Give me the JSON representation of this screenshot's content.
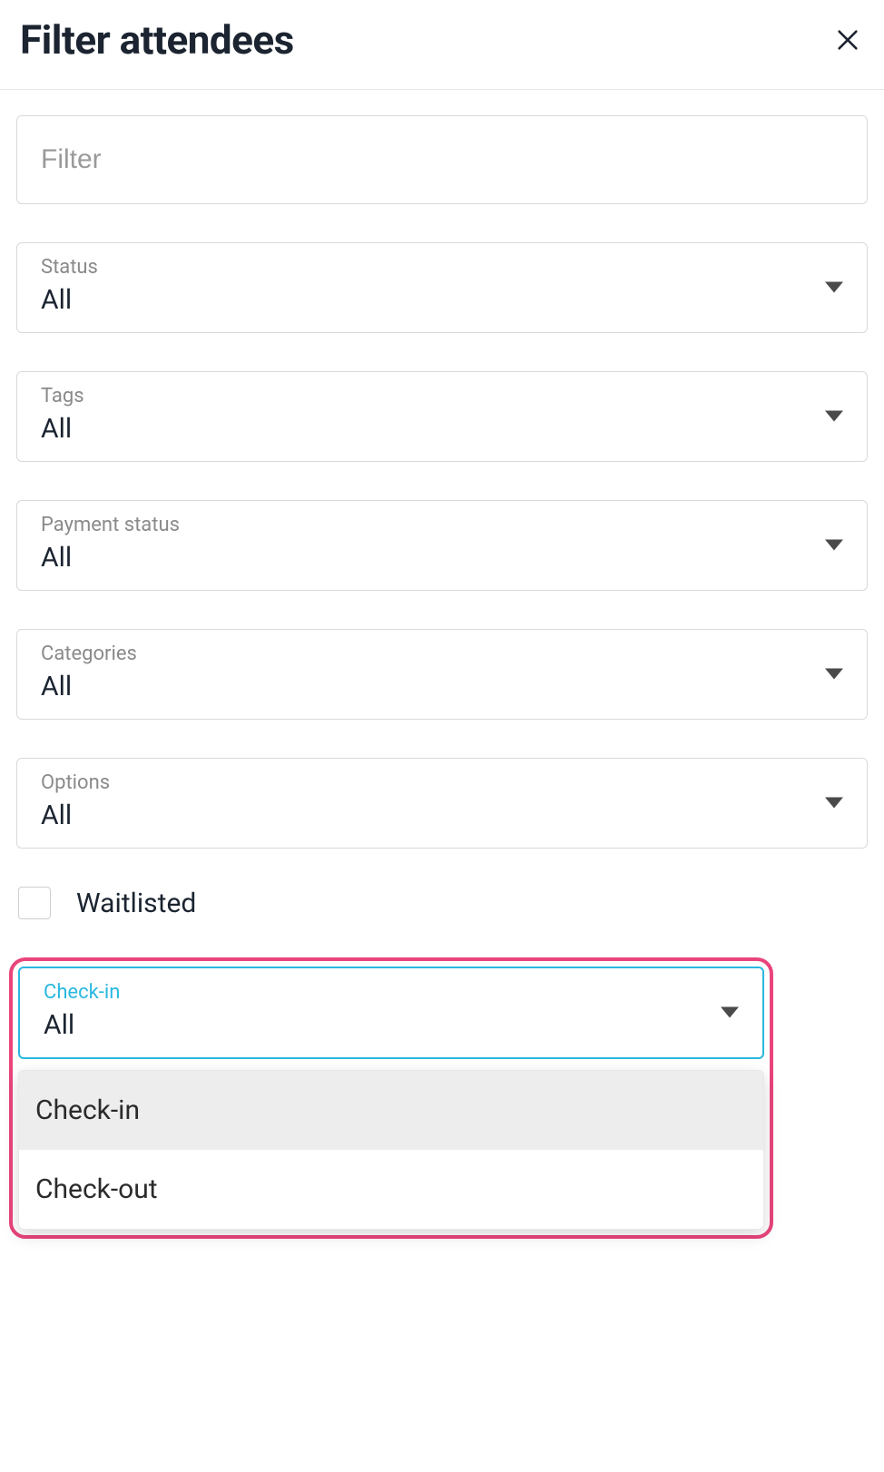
{
  "header": {
    "title": "Filter attendees"
  },
  "filter": {
    "placeholder": "Filter",
    "value": ""
  },
  "selects": {
    "status": {
      "label": "Status",
      "value": "All"
    },
    "tags": {
      "label": "Tags",
      "value": "All"
    },
    "payment_status": {
      "label": "Payment status",
      "value": "All"
    },
    "categories": {
      "label": "Categories",
      "value": "All"
    },
    "options": {
      "label": "Options",
      "value": "All"
    },
    "checkin": {
      "label": "Check-in",
      "value": "All"
    }
  },
  "checkbox": {
    "waitlisted_label": "Waitlisted",
    "waitlisted_checked": false
  },
  "dropdown": {
    "options": [
      "Check-in",
      "Check-out"
    ],
    "option0": "Check-in",
    "option1": "Check-out"
  }
}
